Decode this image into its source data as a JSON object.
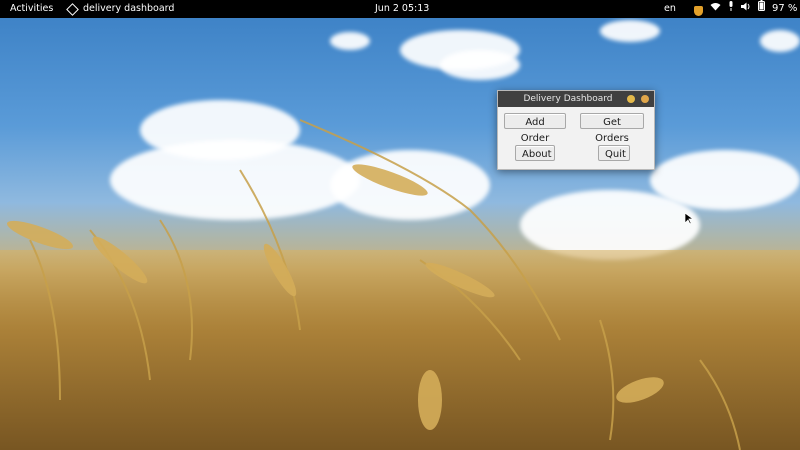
{
  "topbar": {
    "activities": "Activities",
    "app_name": "delivery dashboard",
    "clock": "Jun 2  05:13",
    "language": "en",
    "battery": "97 %"
  },
  "dialog": {
    "title": "Delivery Dashboard",
    "buttons": {
      "add_order": "Add Order",
      "get_orders": "Get Orders",
      "about": "About",
      "quit": "Quit"
    }
  },
  "colors": {
    "topbar_bg": "#000000",
    "titlebar_bg": "#404040",
    "window_bg": "#f2f2f2",
    "window_button": "#e4b94a"
  }
}
